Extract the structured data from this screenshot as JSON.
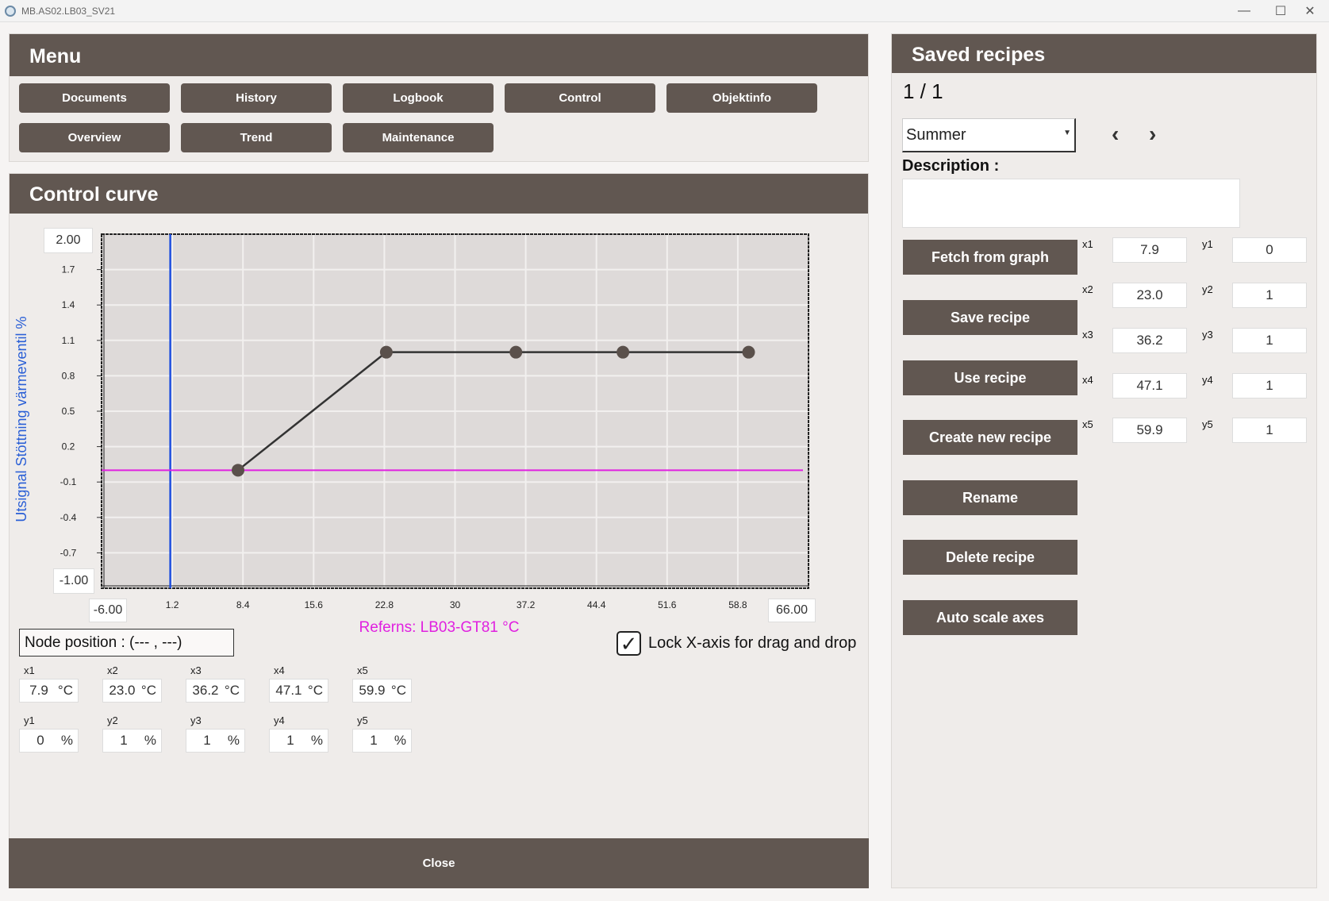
{
  "window": {
    "title": "MB.AS02.LB03_SV21",
    "minimize": "—",
    "maximize": "☐",
    "close": "✕"
  },
  "menu": {
    "title": "Menu",
    "buttons": [
      "Documents",
      "History",
      "Logbook",
      "Control",
      "Objektinfo",
      "Overview",
      "Trend",
      "Maintenance"
    ]
  },
  "control_curve": {
    "title": "Control curve",
    "y_top_value": "2.00",
    "y_bottom_value": "-1.00",
    "x_left_value": "-6.00",
    "x_right_value": "66.00",
    "node_position": "Node position : (--- , ---)",
    "lock_label": "Lock X-axis for drag and drop",
    "lock_checked": true,
    "x_fields": [
      {
        "label": "x1",
        "value": "7.9",
        "unit": "°C"
      },
      {
        "label": "x2",
        "value": "23.0",
        "unit": "°C"
      },
      {
        "label": "x3",
        "value": "36.2",
        "unit": "°C"
      },
      {
        "label": "x4",
        "value": "47.1",
        "unit": "°C"
      },
      {
        "label": "x5",
        "value": "59.9",
        "unit": "°C"
      }
    ],
    "y_fields": [
      {
        "label": "y1",
        "value": "0",
        "unit": "%"
      },
      {
        "label": "y2",
        "value": "1",
        "unit": "%"
      },
      {
        "label": "y3",
        "value": "1",
        "unit": "%"
      },
      {
        "label": "y4",
        "value": "1",
        "unit": "%"
      },
      {
        "label": "y5",
        "value": "1",
        "unit": "%"
      }
    ],
    "close_label": "Close"
  },
  "saved_recipes": {
    "title": "Saved recipes",
    "page": "1 / 1",
    "selected_recipe": "Summer",
    "description_label": "Description :",
    "description": "",
    "prev_icon": "‹",
    "next_icon": "›",
    "buttons": [
      "Fetch from graph",
      "Save recipe",
      "Use recipe",
      "Create new recipe",
      "Rename",
      "Delete recipe",
      "Auto scale axes"
    ],
    "coords": [
      {
        "xl": "x1",
        "x": "7.9",
        "yl": "y1",
        "y": "0"
      },
      {
        "xl": "x2",
        "x": "23.0",
        "yl": "y2",
        "y": "1"
      },
      {
        "xl": "x3",
        "x": "36.2",
        "yl": "y3",
        "y": "1"
      },
      {
        "xl": "x4",
        "x": "47.1",
        "yl": "y4",
        "y": "1"
      },
      {
        "xl": "x5",
        "x": "59.9",
        "yl": "y5",
        "y": "1"
      }
    ]
  },
  "colors": {
    "header": "#615751",
    "plot_bg": "#dedad9",
    "curve": "#333333",
    "node": "#5a504b",
    "reference_line": "#e020e0",
    "marker_line": "#1f4fe0",
    "y_label": "#2a5fd6",
    "x_label": "#e020e0"
  },
  "chart_data": {
    "type": "line",
    "ylabel": "Utsignal Stöttning värmeventil %",
    "xlabel": "Referns: LB03-GT81 °C",
    "xlim": [
      -6,
      66
    ],
    "ylim": [
      -1,
      2
    ],
    "x_ticks": [
      "1.2",
      "8.4",
      "15.6",
      "22.8",
      "30",
      "37.2",
      "44.4",
      "51.6",
      "58.8"
    ],
    "x_tick_values": [
      1.2,
      8.4,
      15.6,
      22.8,
      30,
      37.2,
      44.4,
      51.6,
      58.8
    ],
    "y_ticks": [
      "1.7",
      "1.4",
      "1.1",
      "0.8",
      "0.5",
      "0.2",
      "-0.1",
      "-0.4",
      "-0.7"
    ],
    "y_tick_values": [
      1.7,
      1.4,
      1.1,
      0.8,
      0.5,
      0.2,
      -0.1,
      -0.4,
      -0.7
    ],
    "series": [
      {
        "x": [
          7.9,
          23.0,
          36.2,
          47.1,
          59.9
        ],
        "y": [
          0,
          1,
          1,
          1,
          1
        ]
      }
    ],
    "reference_y": 0,
    "marker_x": 1.0,
    "grid": true
  }
}
